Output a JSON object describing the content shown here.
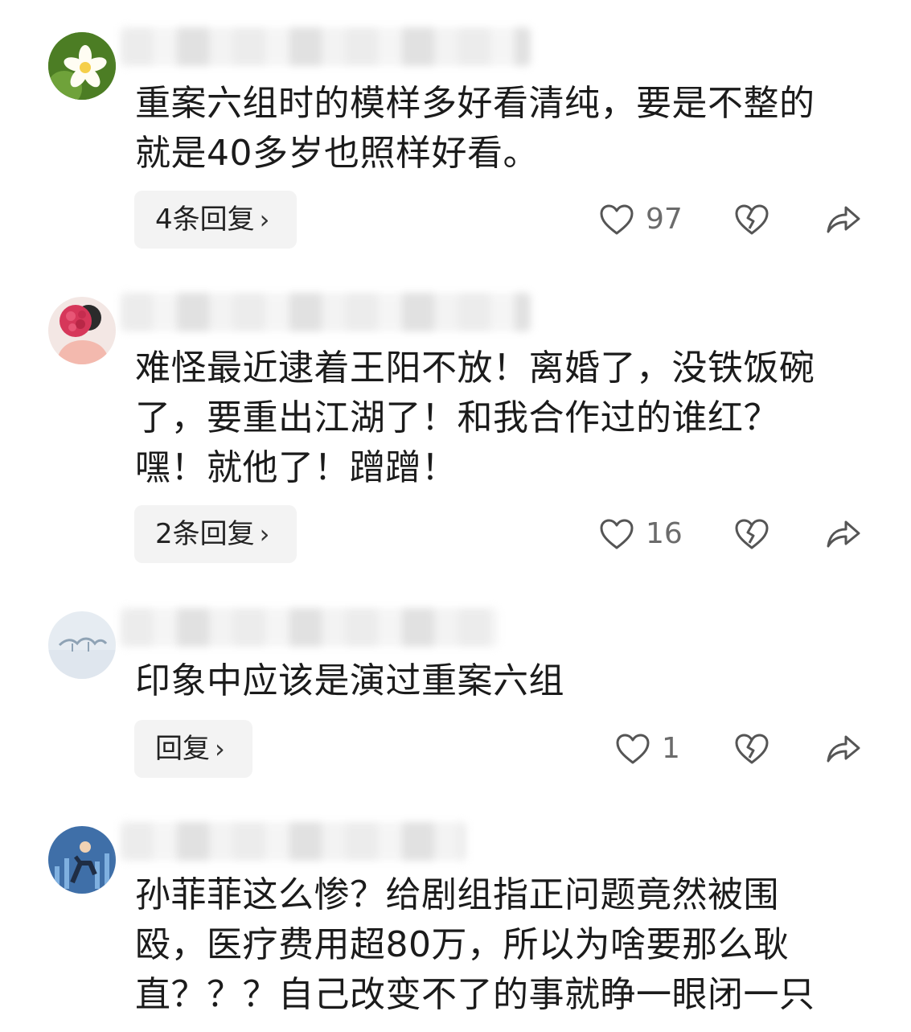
{
  "comments": [
    {
      "text_lines": [
        "重案六组时的模样多好看清纯，要是不整的",
        "就是40多岁也照样好看。"
      ],
      "reply_label": "4条回复",
      "likes": "97"
    },
    {
      "text_lines": [
        "难怪最近逮着王阳不放！离婚了，没铁饭碗",
        "了，要重出江湖了！和我合作过的谁红？",
        "嘿！就他了！蹭蹭！"
      ],
      "reply_label": "2条回复",
      "likes": "16"
    },
    {
      "text_lines": [
        "印象中应该是演过重案六组"
      ],
      "reply_label": "回复",
      "likes": "1"
    },
    {
      "text_lines": [
        "孙菲菲这么惨？给剧组指正问题竟然被围",
        "殴，医疗费用超80万，所以为啥要那么耿",
        "直？？？自己改变不了的事就睁一眼闭一只"
      ],
      "reply_label": "",
      "likes": ""
    }
  ],
  "icons": {
    "like": "heart-outline-icon",
    "dislike": "broken-heart-icon",
    "share": "share-arrow-icon",
    "chevron": "chevron-right-icon"
  },
  "chevron_glyph": "›"
}
